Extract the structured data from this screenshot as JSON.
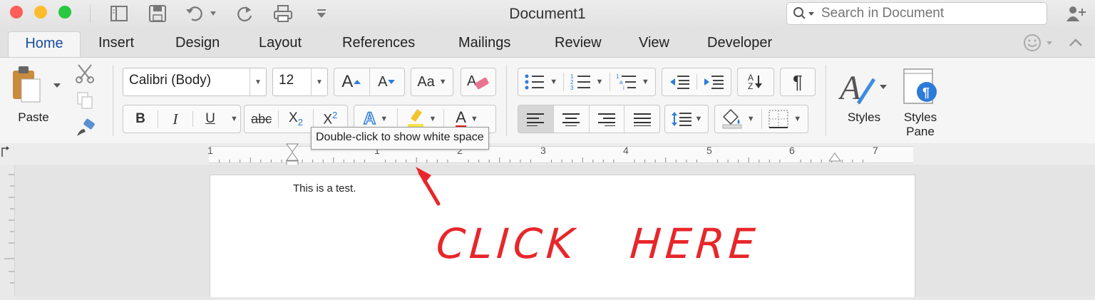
{
  "window": {
    "title": "Document1",
    "colors": {
      "close": "#fc5f57",
      "minimize": "#fdbc2e",
      "zoom": "#28c840"
    }
  },
  "search": {
    "placeholder": "Search in Document"
  },
  "tabs": [
    {
      "label": "Home",
      "active": true
    },
    {
      "label": "Insert"
    },
    {
      "label": "Design"
    },
    {
      "label": "Layout"
    },
    {
      "label": "References"
    },
    {
      "label": "Mailings"
    },
    {
      "label": "Review"
    },
    {
      "label": "View"
    },
    {
      "label": "Developer"
    }
  ],
  "ribbon": {
    "paste_label": "Paste",
    "font_name": "Calibri (Body)",
    "font_size": "12",
    "bold": "B",
    "italic": "I",
    "underline": "U",
    "strike": "abc",
    "subscript": "X",
    "subscript_sub": "2",
    "superscript": "X",
    "superscript_sup": "2",
    "grow_font": "A",
    "shrink_font": "A",
    "change_case": "Aa",
    "text_effects": "A",
    "font_color": "A",
    "pilcrow": "¶",
    "sort_a": "A",
    "sort_z": "Z",
    "styles_label": "Styles",
    "styles_pane_label_1": "Styles",
    "styles_pane_label_2": "Pane",
    "accent": "#1a4d9e"
  },
  "tooltip": "Double-click to show white space",
  "ruler": {
    "labels": [
      "1",
      "1",
      "2",
      "3",
      "4",
      "5",
      "6",
      "7"
    ]
  },
  "document": {
    "body_text": "This is a test."
  },
  "annotation": {
    "text": "CLICK   HERE",
    "color": "#e8262a"
  }
}
